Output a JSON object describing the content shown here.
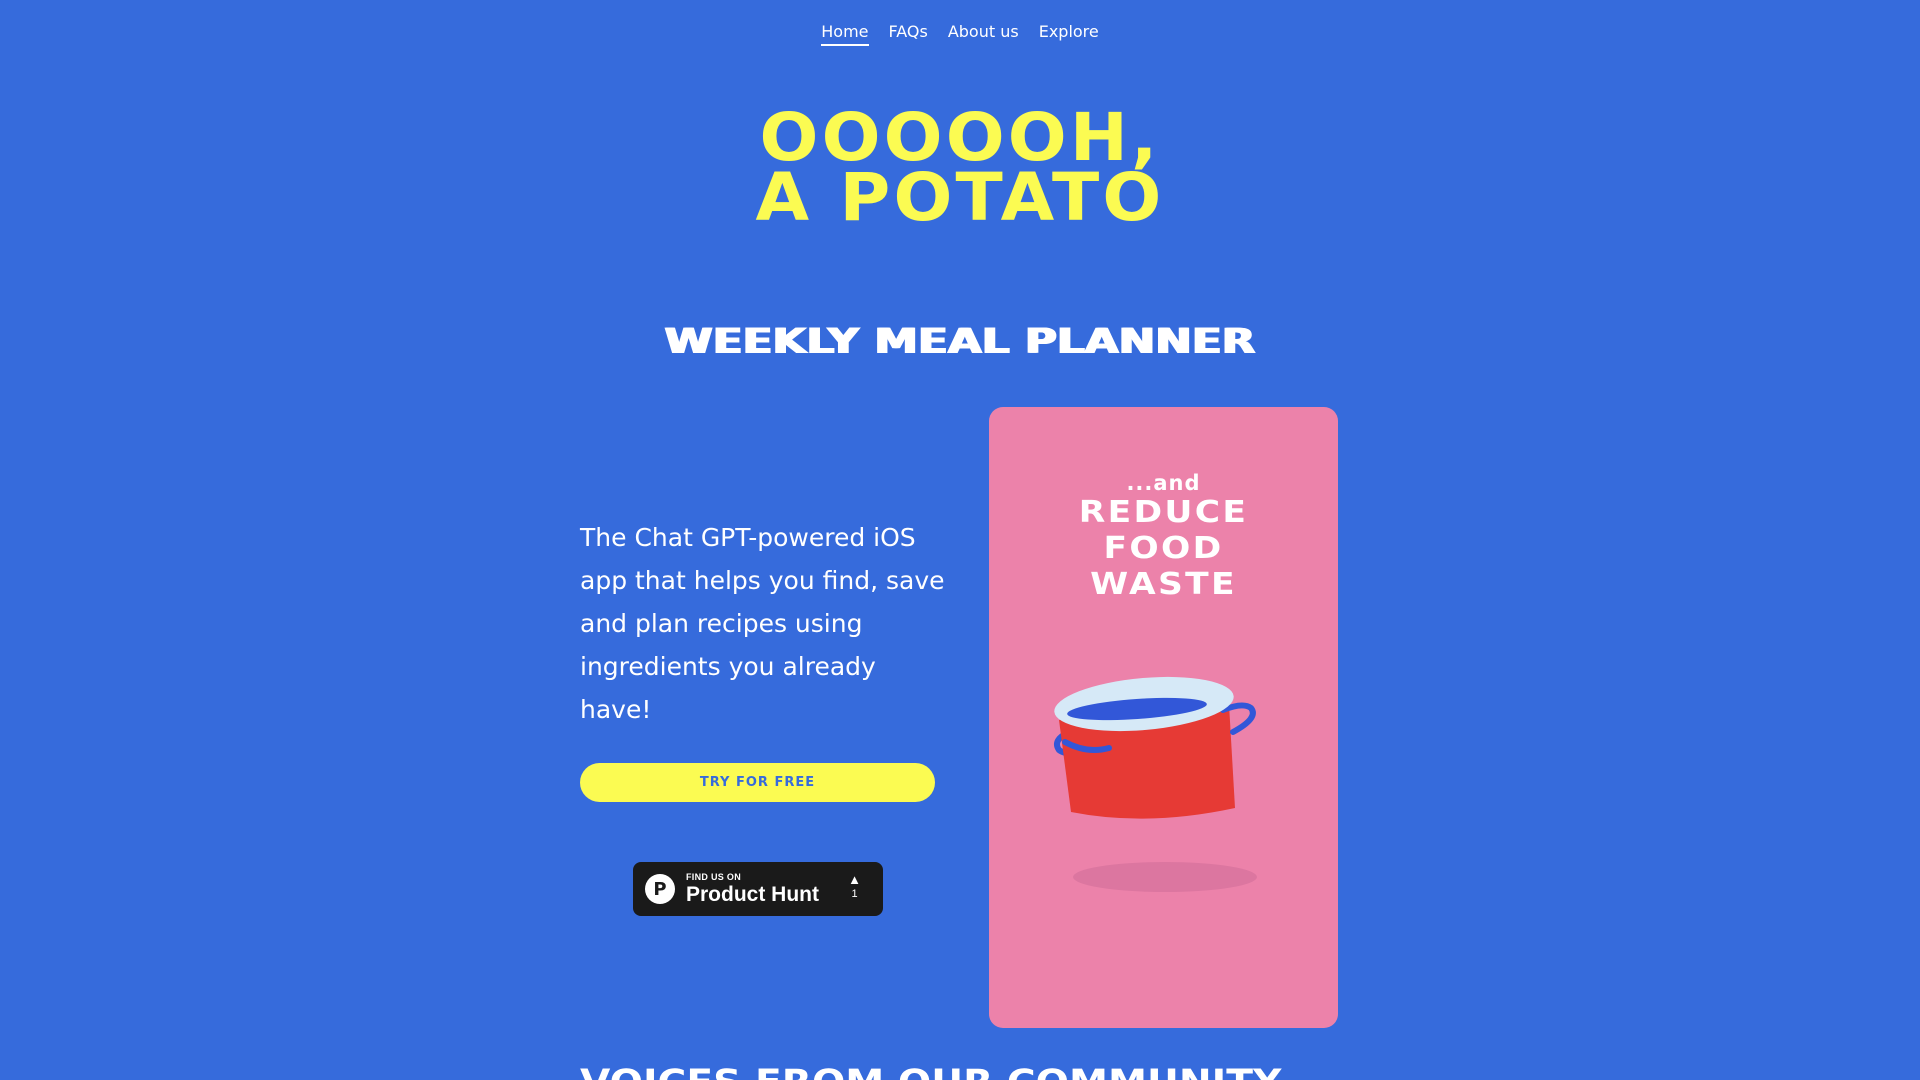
{
  "nav": {
    "items": [
      {
        "label": "Home",
        "active": true
      },
      {
        "label": "FAQs",
        "active": false
      },
      {
        "label": "About us",
        "active": false
      },
      {
        "label": "Explore",
        "active": false
      }
    ]
  },
  "hero": {
    "logo_line1": "OOOOOH,",
    "logo_line2": "A POTATO"
  },
  "section": {
    "title": "WEEKLY MEAL PLANNER",
    "tagline": "The Chat GPT-powered iOS app that helps you find, save and plan recipes using ingredients you already have!",
    "cta_label": "TRY FOR FREE"
  },
  "product_hunt": {
    "small_label": "FIND US ON",
    "big_label": "Product Hunt",
    "vote_count": "1",
    "logo_letter": "P"
  },
  "card": {
    "small_text": "...and",
    "line1": "REDUCE",
    "line2": "FOOD",
    "line3": "WASTE"
  },
  "bottom": {
    "heading": "VOICES FROM OUR COMMUNITY"
  },
  "colors": {
    "background": "#366bdc",
    "accent_yellow": "#fbfb52",
    "card_pink": "#ec82aa",
    "pot_red": "#e63a35",
    "badge_dark": "#1a1a1a"
  },
  "icons": {
    "pot": "cooking-pot-icon",
    "product_hunt": "product-hunt-logo-icon",
    "upvote": "upvote-arrow-icon"
  }
}
